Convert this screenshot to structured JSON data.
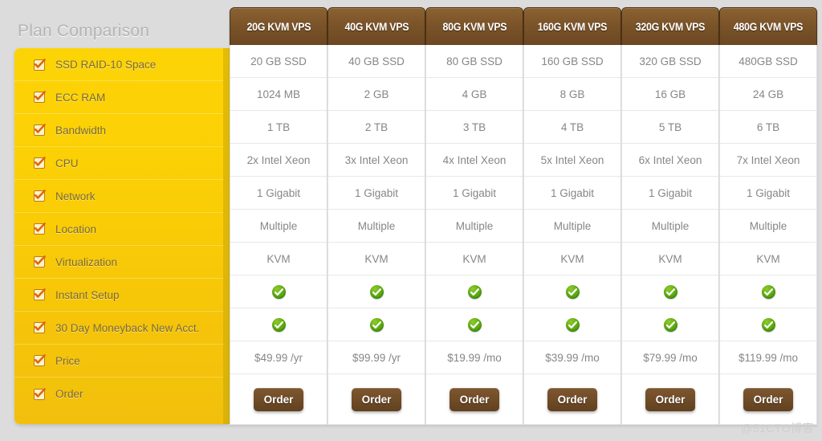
{
  "sidebar": {
    "title": "Plan Comparison",
    "checkbox_icon": "checkbox-checked-icon",
    "items": [
      {
        "label": "SSD RAID-10 Space"
      },
      {
        "label": "ECC RAM"
      },
      {
        "label": "Bandwidth"
      },
      {
        "label": "CPU"
      },
      {
        "label": "Network"
      },
      {
        "label": "Location"
      },
      {
        "label": "Virtualization"
      },
      {
        "label": "Instant Setup"
      },
      {
        "label": "30 Day Moneyback New Acct."
      },
      {
        "label": "Price"
      },
      {
        "label": "Order"
      }
    ]
  },
  "table": {
    "row_keys": [
      "ssd",
      "ram",
      "bandwidth",
      "cpu",
      "network",
      "location",
      "virtualization",
      "instant_setup",
      "moneyback",
      "price",
      "order"
    ],
    "check_icon": "green-check-icon",
    "order_label": "Order",
    "plans": [
      {
        "name": "20G KVM VPS",
        "ssd": "20 GB SSD",
        "ram": "1024 MB",
        "bandwidth": "1 TB",
        "cpu": "2x Intel Xeon",
        "network": "1 Gigabit",
        "location": "Multiple",
        "virtualization": "KVM",
        "instant_setup": true,
        "moneyback": true,
        "price": "$49.99 /yr"
      },
      {
        "name": "40G KVM VPS",
        "ssd": "40 GB SSD",
        "ram": "2 GB",
        "bandwidth": "2 TB",
        "cpu": "3x Intel Xeon",
        "network": "1 Gigabit",
        "location": "Multiple",
        "virtualization": "KVM",
        "instant_setup": true,
        "moneyback": true,
        "price": "$99.99 /yr"
      },
      {
        "name": "80G KVM VPS",
        "ssd": "80 GB SSD",
        "ram": "4 GB",
        "bandwidth": "3 TB",
        "cpu": "4x Intel Xeon",
        "network": "1 Gigabit",
        "location": "Multiple",
        "virtualization": "KVM",
        "instant_setup": true,
        "moneyback": true,
        "price": "$19.99 /mo"
      },
      {
        "name": "160G KVM VPS",
        "ssd": "160 GB SSD",
        "ram": "8 GB",
        "bandwidth": "4 TB",
        "cpu": "5x Intel Xeon",
        "network": "1 Gigabit",
        "location": "Multiple",
        "virtualization": "KVM",
        "instant_setup": true,
        "moneyback": true,
        "price": "$39.99 /mo"
      },
      {
        "name": "320G KVM VPS",
        "ssd": "320 GB SSD",
        "ram": "16 GB",
        "bandwidth": "5 TB",
        "cpu": "6x Intel Xeon",
        "network": "1 Gigabit",
        "location": "Multiple",
        "virtualization": "KVM",
        "instant_setup": true,
        "moneyback": true,
        "price": "$79.99 /mo"
      },
      {
        "name": "480G KVM VPS",
        "ssd": "480GB SSD",
        "ram": "24 GB",
        "bandwidth": "6 TB",
        "cpu": "7x Intel Xeon",
        "network": "1 Gigabit",
        "location": "Multiple",
        "virtualization": "KVM",
        "instant_setup": true,
        "moneyback": true,
        "price": "$119.99 /mo"
      }
    ]
  },
  "watermark": "@51CTO博客",
  "colors": {
    "page_bg": "#dcdcdc",
    "panel_gold": "#fbcf05",
    "gold_edge": "#dab30a",
    "header_brown": "#7b5429",
    "button_brown": "#704c27",
    "cell_text": "#868686",
    "check_green": "#63ad12"
  }
}
